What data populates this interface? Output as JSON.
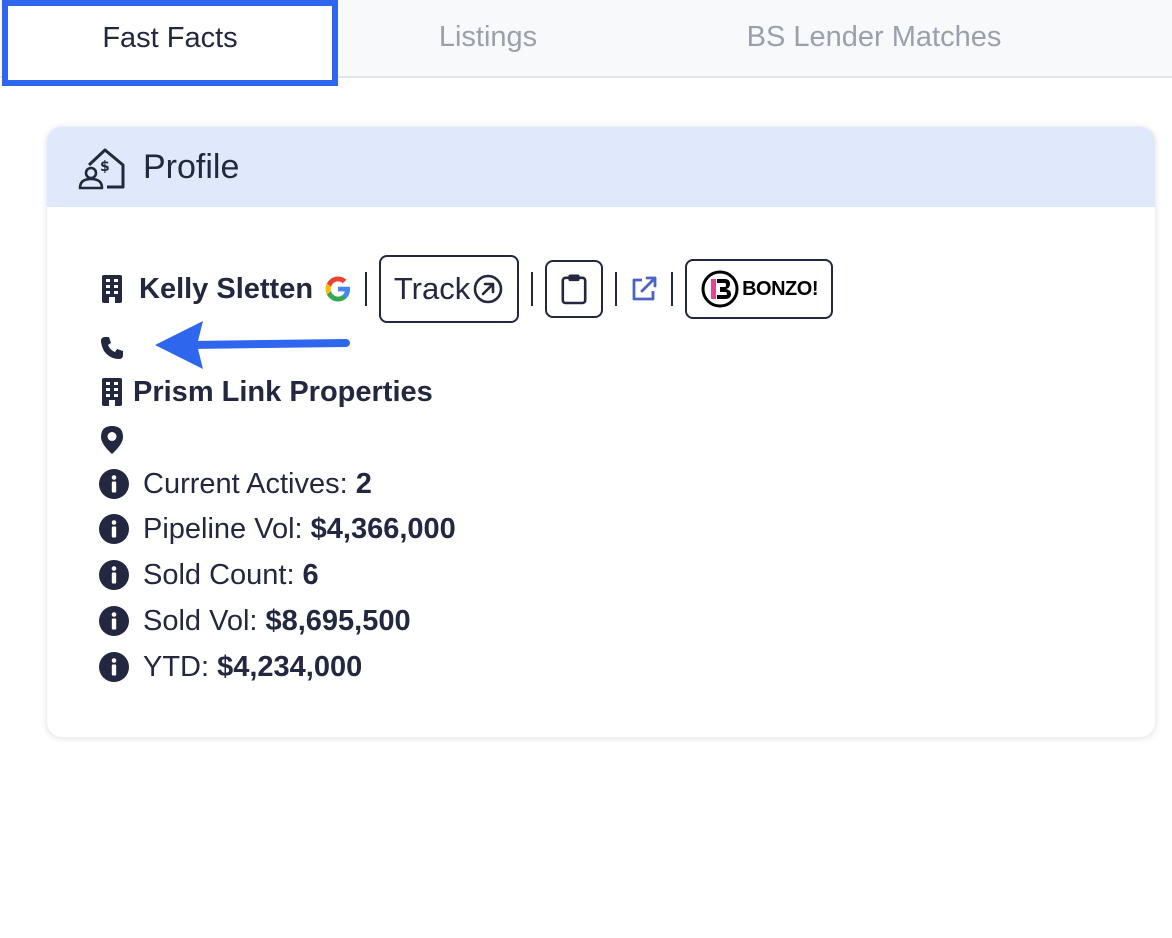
{
  "tabs": [
    {
      "label": "Fast Facts",
      "active": true
    },
    {
      "label": "Listings",
      "active": false
    },
    {
      "label": "BS Lender Matches",
      "active": false
    }
  ],
  "profile": {
    "title": "Profile",
    "agent_name": "Kelly Sletten",
    "track_label": "Track",
    "bonzo_label": "BONZO!",
    "company": "Prism Link Properties",
    "stats": [
      {
        "label": "Current Actives:",
        "value": "2"
      },
      {
        "label": "Pipeline Vol:",
        "value": "$4,366,000"
      },
      {
        "label": "Sold Count:",
        "value": "6"
      },
      {
        "label": "Sold Vol:",
        "value": "$8,695,500"
      },
      {
        "label": "YTD:",
        "value": "$4,234,000"
      }
    ]
  },
  "colors": {
    "accent_blue": "#2f66ee",
    "header_bg": "#dfe9fb",
    "text_dark": "#23273f",
    "link_blue": "#4b63c4"
  }
}
